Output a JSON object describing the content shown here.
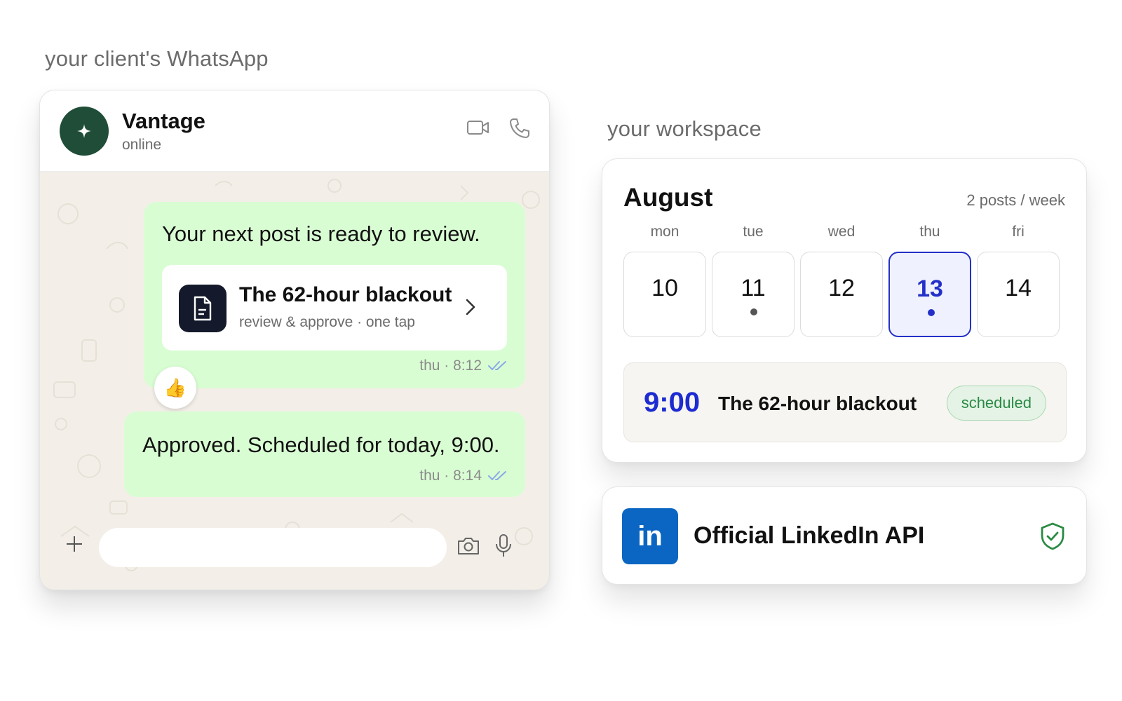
{
  "labels": {
    "whatsapp": "your client's WhatsApp",
    "workspace": "your workspace"
  },
  "whatsapp": {
    "contact_name": "Vantage",
    "contact_status": "online",
    "messages": [
      {
        "text": "Your next post is ready to review.",
        "card": {
          "title": "The 62-hour blackout",
          "subtitle": "review & approve · one tap"
        },
        "meta": "thu · 8:12",
        "reaction": "👍"
      },
      {
        "text": "Approved. Scheduled for today, 9:00.",
        "meta": "thu · 8:14"
      }
    ],
    "input": {
      "value": "",
      "placeholder": ""
    },
    "icons": [
      "sparkle-icon",
      "video-icon",
      "phone-icon",
      "document-icon",
      "chevron-right-icon",
      "double-check-icon",
      "plus-icon",
      "camera-icon",
      "microphone-icon"
    ]
  },
  "calendar": {
    "month": "August",
    "frequency": "2 posts / week",
    "days": [
      {
        "name": "mon",
        "num": "10",
        "dot": false,
        "selected": false
      },
      {
        "name": "tue",
        "num": "11",
        "dot": true,
        "selected": false
      },
      {
        "name": "wed",
        "num": "12",
        "dot": false,
        "selected": false
      },
      {
        "name": "thu",
        "num": "13",
        "dot": true,
        "selected": true
      },
      {
        "name": "fri",
        "num": "14",
        "dot": false,
        "selected": false
      }
    ],
    "scheduled": {
      "time": "9:00",
      "title": "The 62-hour blackout",
      "status": "scheduled"
    }
  },
  "linkedin": {
    "logo_text": "in",
    "text": "Official LinkedIn API",
    "icon": "shield-check-icon"
  },
  "colors": {
    "avatar": "#1f4d38",
    "bubble": "#d9fdd3",
    "chat_bg": "#f3efe8",
    "accent_blue": "#1d2bd1",
    "badge_green": "#2a8a44",
    "linkedin_blue": "#0a66c2"
  }
}
